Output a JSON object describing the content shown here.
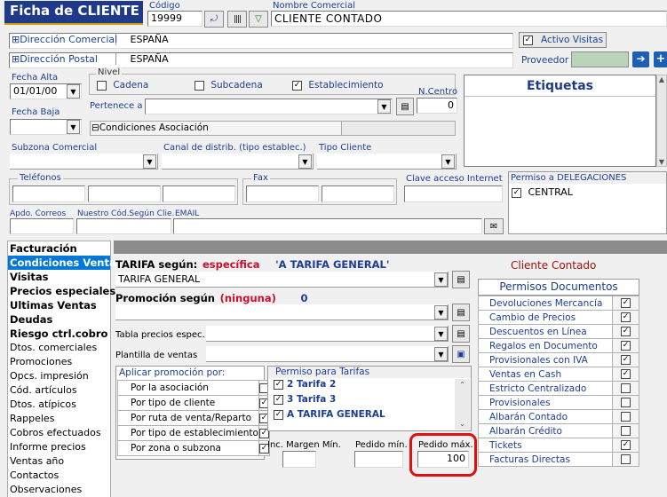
{
  "header": {
    "title": "Ficha de CLIENTE",
    "codigo_label": "Código",
    "codigo_value": "19999",
    "nombre_label": "Nombre Comercial",
    "nombre_value": "CLIENTE CONTADO"
  },
  "direcciones": {
    "comercial_label": "⊞Dirección Comercial",
    "comercial_value": "ESPAÑA",
    "postal_label": "⊞Dirección Postal",
    "postal_value": "ESPAÑA"
  },
  "activo_visitas": {
    "label": "Activo Visitas",
    "checked": true
  },
  "proveedor_label": "Proveedor",
  "fecha_alta": {
    "label": "Fecha Alta",
    "value": "01/01/00"
  },
  "fecha_baja": {
    "label": "Fecha Baja",
    "value": ""
  },
  "nivel": {
    "label": "Nivel",
    "options": [
      {
        "label": "Cadena",
        "checked": false
      },
      {
        "label": "Subcadena",
        "checked": false
      },
      {
        "label": "Establecimiento",
        "checked": true
      }
    ]
  },
  "ncentro": {
    "label": "N.Centro",
    "value": "0"
  },
  "etiquetas_label": "Etiquetas",
  "pertenece_label": "Pertenece a",
  "condiciones_asociacion": "⊟Condiciones Asociación",
  "subzona_label": "Subzona Comercial",
  "canal_label": "Canal de distrib. (tipo establec.)",
  "tipo_cliente_label": "Tipo Cliente",
  "telefonos_label": "Teléfonos",
  "fax_label": "Fax",
  "clave_label": "Clave acceso Internet",
  "permiso_delegaciones": {
    "label": "Permiso a DELEGACIONES",
    "items": [
      {
        "label": "CENTRAL",
        "checked": true
      }
    ]
  },
  "apdo_label": "Apdo. Correos",
  "nuestro_cod_label": "Nuestro Cód.Según Clie.",
  "email_label": "EMAIL",
  "nav": [
    {
      "label": "Facturación",
      "bold": true,
      "selected": false
    },
    {
      "label": "Condiciones Venta",
      "bold": true,
      "selected": true
    },
    {
      "label": "Visitas",
      "bold": true,
      "selected": false
    },
    {
      "label": "Precios especiales",
      "bold": true,
      "selected": false
    },
    {
      "label": "Ultimas Ventas",
      "bold": true,
      "selected": false
    },
    {
      "label": "Deudas",
      "bold": true,
      "selected": false
    },
    {
      "label": "Riesgo ctrl.cobro",
      "bold": true,
      "selected": false
    },
    {
      "label": "Dtos. comerciales",
      "bold": false,
      "selected": false
    },
    {
      "label": "Promociones",
      "bold": false,
      "selected": false
    },
    {
      "label": "Opcs. impresión",
      "bold": false,
      "selected": false
    },
    {
      "label": "Cód. artículos",
      "bold": false,
      "selected": false
    },
    {
      "label": "Dtos. atípicos",
      "bold": false,
      "selected": false
    },
    {
      "label": "Rappeles",
      "bold": false,
      "selected": false
    },
    {
      "label": "Cobros efectuados",
      "bold": false,
      "selected": false
    },
    {
      "label": "Informe precios",
      "bold": false,
      "selected": false
    },
    {
      "label": "Ventas año",
      "bold": false,
      "selected": false
    },
    {
      "label": "Contactos",
      "bold": false,
      "selected": false
    },
    {
      "label": "Observaciones",
      "bold": false,
      "selected": false
    }
  ],
  "tarifa": {
    "label": "TARIFA según:",
    "tipo": "específica",
    "nombre": "'A TARIFA GENERAL'",
    "value": "TARIFA GENERAL"
  },
  "cliente_contado": "Cliente Contado",
  "promocion": {
    "label": "Promoción según",
    "tipo": "(ninguna)",
    "num": "0"
  },
  "tabla_precios_label": "Tabla precios espec.",
  "plantilla_label": "Plantilla de ventas",
  "aplicar": {
    "label": "Aplicar promoción por:",
    "rows": [
      {
        "label": "Por la asociación",
        "checked": false
      },
      {
        "label": "Por tipo de cliente",
        "checked": true
      },
      {
        "label": "Por ruta de venta/Reparto",
        "checked": true
      },
      {
        "label": "Por tipo de establecimiento",
        "checked": true
      },
      {
        "label": "Por zona o subzona",
        "checked": true
      }
    ]
  },
  "permiso_tarifas": {
    "label": "Permiso para Tarifas",
    "items": [
      {
        "label": "2 Tarifa 2",
        "checked": true
      },
      {
        "label": "3 Tarifa 3",
        "checked": true
      },
      {
        "label": "A TARIFA GENERAL",
        "checked": true
      }
    ]
  },
  "inc_margen_label": "Inc. Margen Mín.",
  "pedido_min_label": "Pedido mín.",
  "pedido_max": {
    "label": "Pedido máx.",
    "value": "100"
  },
  "permisos_documentos": {
    "title": "Permisos Documentos",
    "rows": [
      {
        "label": "Devoluciones Mercancía",
        "checked": true
      },
      {
        "label": "Cambio de Precios",
        "checked": true
      },
      {
        "label": "Descuentos en Línea",
        "checked": true
      },
      {
        "label": "Regalos en Documento",
        "checked": true
      },
      {
        "label": "Provisionales con IVA",
        "checked": true
      },
      {
        "label": "Ventas en Cash",
        "checked": true
      },
      {
        "label": "Estricto Centralizado",
        "checked": false
      },
      {
        "label": "Provisionales",
        "checked": false
      },
      {
        "label": "Albarán Contado",
        "checked": false
      },
      {
        "label": "Albarán Crédito",
        "checked": false
      },
      {
        "label": "Tickets",
        "checked": true
      },
      {
        "label": "Facturas Directas",
        "checked": false
      }
    ]
  },
  "colors": {
    "title_bg": "#1f3a8a",
    "accent_blue": "#1c3f94",
    "selection": "#0078d7",
    "highlight_red": "#e01010",
    "proveedor_bg": "#b9d4b9"
  }
}
